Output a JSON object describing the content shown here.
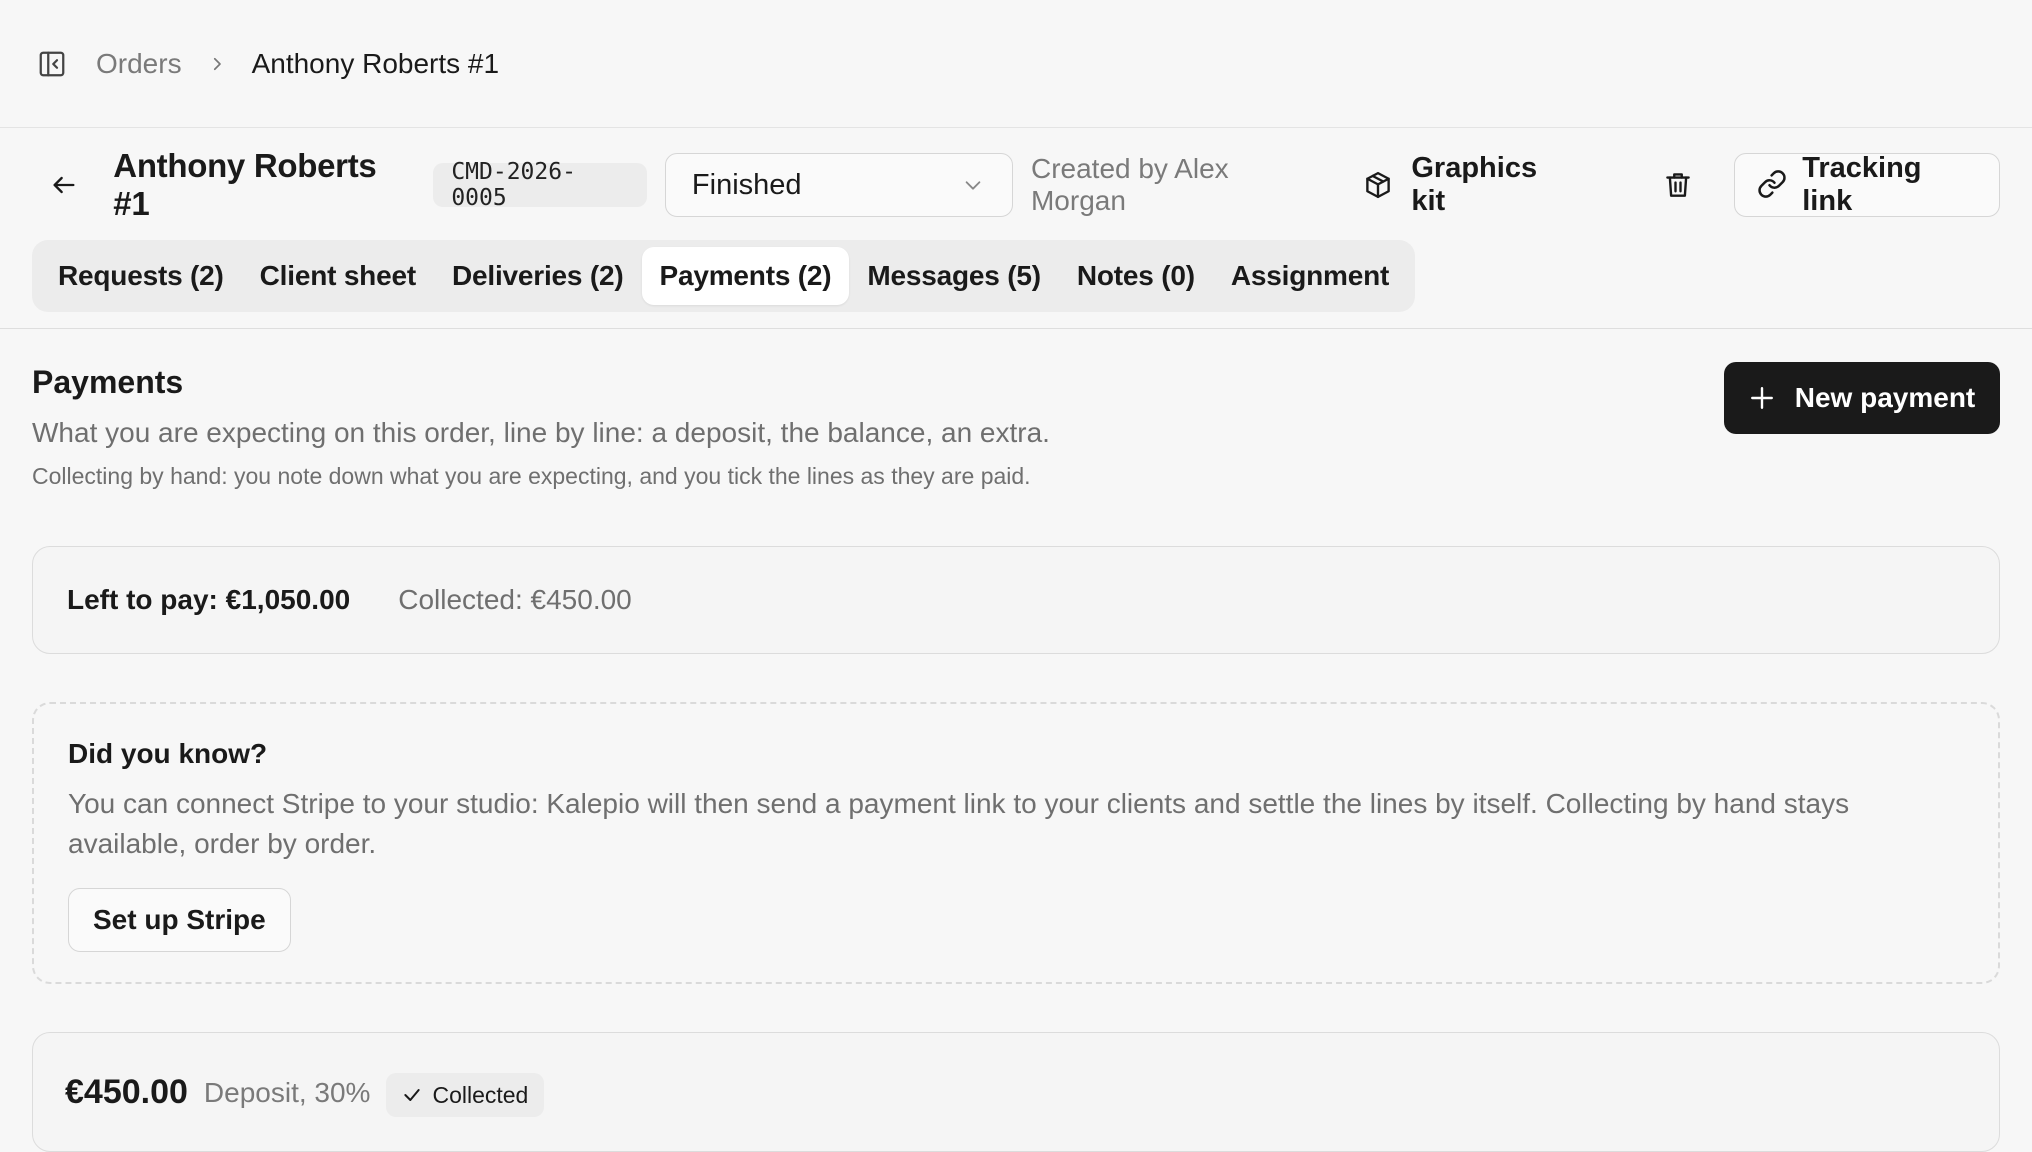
{
  "breadcrumb": {
    "toggle_icon": "sidebar-collapse-icon",
    "parent": "Orders",
    "separator_icon": "chevron-right-icon",
    "current": "Anthony Roberts #1"
  },
  "header": {
    "back_icon": "arrow-left-icon",
    "title": "Anthony Roberts #1",
    "code": "CMD-2026-0005",
    "status": {
      "selected": "Finished",
      "chevron_icon": "chevron-down-icon"
    },
    "created_by": "Created by Alex Morgan",
    "graphics_kit": {
      "label": "Graphics kit",
      "icon": "package-icon"
    },
    "delete_icon": "trash-icon",
    "tracking": {
      "label": "Tracking link",
      "icon": "link-icon"
    }
  },
  "tabs": [
    {
      "label": "Requests (2)",
      "active": false
    },
    {
      "label": "Client sheet",
      "active": false
    },
    {
      "label": "Deliveries (2)",
      "active": false
    },
    {
      "label": "Payments (2)",
      "active": true
    },
    {
      "label": "Messages (5)",
      "active": false
    },
    {
      "label": "Notes (0)",
      "active": false
    },
    {
      "label": "Assignment",
      "active": false
    }
  ],
  "payments": {
    "title": "Payments",
    "description": "What you are expecting on this order, line by line: a deposit, the balance, an extra.",
    "subdescription": "Collecting by hand: you note down what you are expecting, and you tick the lines as they are paid.",
    "new_button": "New payment",
    "new_icon": "plus-icon",
    "summary": {
      "left_to_pay": "Left to pay: €1,050.00",
      "collected": "Collected: €450.00"
    },
    "tip": {
      "title": "Did you know?",
      "text": "You can connect Stripe to your studio: Kalepio will then send a payment link to your clients and settle the lines by itself. Collecting by hand stays available, order by order.",
      "button": "Set up Stripe"
    },
    "lines": [
      {
        "amount": "€450.00",
        "label": "Deposit, 30%",
        "status": "Collected",
        "status_icon": "check-icon"
      }
    ]
  },
  "colors": {
    "background": "#f7f7f7",
    "primary_button": "#1a1a1a",
    "muted_text": "#6f6f6f",
    "border": "#dcdcdc"
  }
}
